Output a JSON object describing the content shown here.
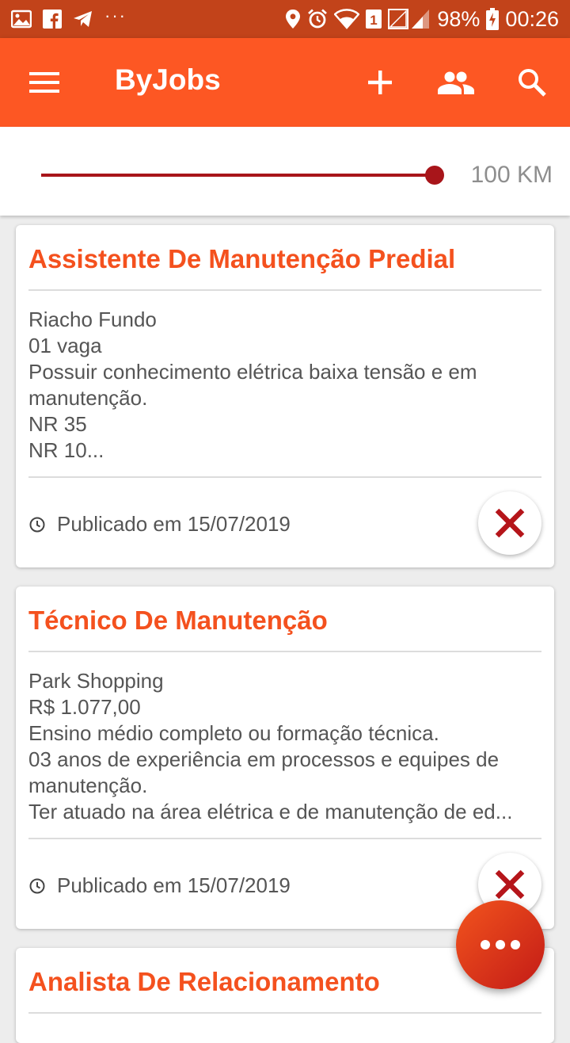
{
  "status_bar": {
    "battery": "98%",
    "time": "00:26",
    "icons": [
      "gallery-icon",
      "facebook-icon",
      "telegram-icon",
      "more-notifications-icon",
      "location-icon",
      "alarm-icon",
      "wifi-icon",
      "sim-1-icon",
      "signal-icon",
      "battery-charging-icon"
    ]
  },
  "app_bar": {
    "title": "ByJobs",
    "actions": [
      "add-icon",
      "people-icon",
      "search-icon"
    ]
  },
  "distance_filter": {
    "value_label": "100 KM",
    "fraction": 1.0
  },
  "colors": {
    "primary": "#fd5723",
    "status_bar": "#c2431a",
    "title_text": "#f4511e",
    "accent_red": "#a8151a"
  },
  "jobs": [
    {
      "title": "Assistente De Manutenção Predial",
      "lines": [
        "Riacho Fundo",
        "01 vaga",
        "Possuir conhecimento elétrica baixa tensão e em",
        "manutenção.",
        "NR 35",
        "NR 10..."
      ],
      "published": "Publicado em 15/07/2019"
    },
    {
      "title": "Técnico De Manutenção",
      "lines": [
        "Park Shopping",
        "R$ 1.077,00",
        "Ensino médio completo ou formação técnica.",
        "03 anos de experiência em processos e equipes de",
        "manutenção.",
        "Ter atuado na área elétrica e de manutenção de ed..."
      ],
      "published": "Publicado em 15/07/2019"
    },
    {
      "title": "Analista De Relacionamento",
      "lines": [],
      "published": ""
    }
  ]
}
